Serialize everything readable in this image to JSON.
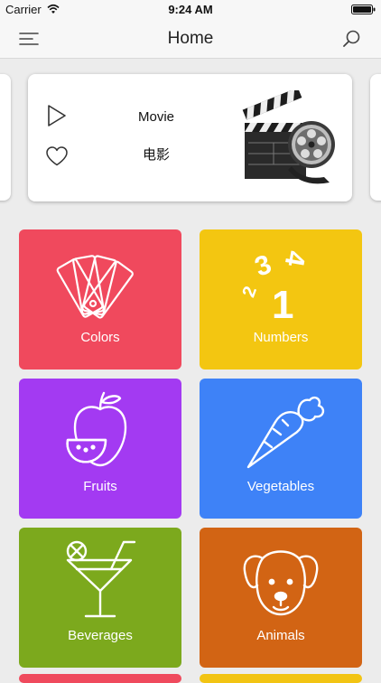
{
  "status_bar": {
    "carrier": "Carrier",
    "time": "9:24 AM",
    "wifi_icon": "wifi-icon",
    "battery_icon": "battery-icon"
  },
  "nav": {
    "title": "Home",
    "menu_icon": "hamburger-menu-icon",
    "search_icon": "search-icon"
  },
  "featured_card": {
    "title": "Movie",
    "subtitle": "电影",
    "play_icon": "play-icon",
    "favorite_icon": "heart-icon",
    "image": "movie-clapperboard-and-film-reel"
  },
  "categories": [
    {
      "label": "Colors",
      "color": "#f0495d",
      "icon": "color-swatch-icon"
    },
    {
      "label": "Numbers",
      "color": "#f3c611",
      "icon": "numbers-icon"
    },
    {
      "label": "Fruits",
      "color": "#a33af2",
      "icon": "apple-icon"
    },
    {
      "label": "Vegetables",
      "color": "#3e82f7",
      "icon": "carrot-icon"
    },
    {
      "label": "Beverages",
      "color": "#7ca91d",
      "icon": "cocktail-icon"
    },
    {
      "label": "Animals",
      "color": "#d26414",
      "icon": "dog-icon"
    },
    {
      "label": "",
      "color": "#ef4a5d",
      "icon": ""
    },
    {
      "label": "",
      "color": "#f2c413",
      "icon": ""
    }
  ]
}
